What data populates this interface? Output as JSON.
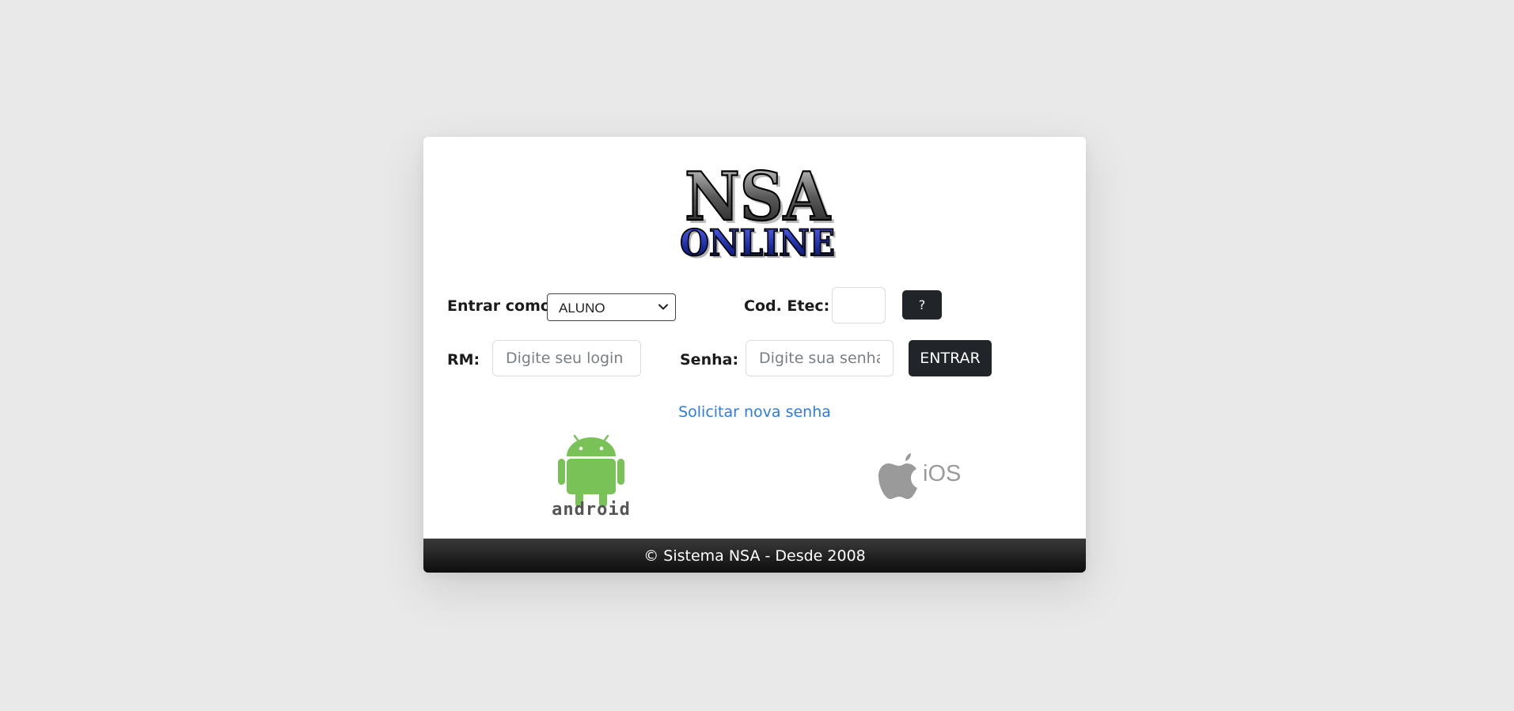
{
  "logo": {
    "line1": "NSA",
    "line2": "ONLINE"
  },
  "login": {
    "role_label": "Entrar como:",
    "role_value": "ALUNO",
    "etec_label": "Cod. Etec:",
    "etec_value": "",
    "help_button": "?",
    "rm_label": "RM:",
    "rm_placeholder": "Digite seu login",
    "password_label": "Senha:",
    "password_placeholder": "Digite sua senha",
    "submit_button": "ENTRAR",
    "forgot_link": "Solicitar nova senha"
  },
  "stores": {
    "android_text": "android",
    "ios_text": "iOS"
  },
  "footer": {
    "text": "© Sistema NSA - Desde 2008"
  },
  "colors": {
    "page_bg": "#e9e9e9",
    "card_bg": "#ffffff",
    "button_dark": "#212529",
    "link": "#2d7be5",
    "android_green": "#78c257",
    "ios_gray": "#9a9a9a",
    "logo_blue": "#1a2a9c"
  }
}
